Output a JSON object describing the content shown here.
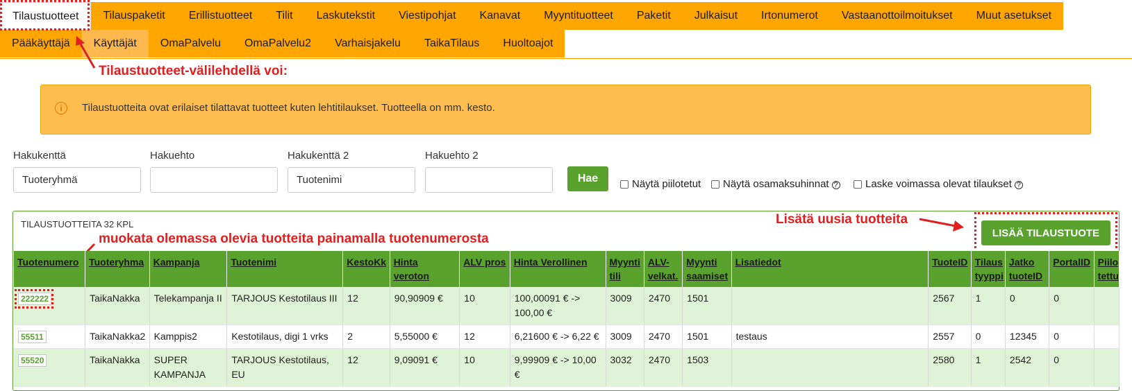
{
  "tabs_row1": [
    "Tilaustuotteet",
    "Tilauspaketit",
    "Erillistuotteet",
    "Tilit",
    "Laskutekstit",
    "Viestipohjat",
    "Kanavat",
    "Myyntituotteet",
    "Paketit",
    "Julkaisut",
    "Irtonumerot",
    "Vastaanottoilmoitukset",
    "Muut asetukset"
  ],
  "tabs_row2": [
    "Pääkäyttäjä",
    "Käyttäjät",
    "OmaPalvelu",
    "OmaPalvelu2",
    "Varhaisjakelu",
    "TaikaTilaus",
    "Huoltoajot"
  ],
  "annotations": {
    "tab_note": "Tilaustuotteet-välilehdellä voi:",
    "add_note": "Lisätä uusia tuotteita",
    "edit_note": "muokata olemassa olevia tuotteita painamalla tuotenumerosta"
  },
  "info": {
    "icon": "info-circle-icon",
    "text": "Tilaustuotteita ovat erilaiset tilattavat tuotteet kuten lehtitilaukset. Tuotteella on mm. kesto."
  },
  "search": {
    "label1": "Hakukenttä",
    "value1": "Tuoteryhmä",
    "label2": "Hakuehto",
    "value2": "",
    "label3": "Hakukenttä 2",
    "value3": "Tuotenimi",
    "label4": "Hakuehto 2",
    "value4": "",
    "button": "Hae",
    "check1": "Näytä piilotetut",
    "check2": "Näytä osamaksuhinnat",
    "check3": "Laske voimassa olevat tilaukset",
    "help": "?"
  },
  "list": {
    "title": "TILAUSTUOTTEITA 32 KPL",
    "add_button": "LISÄÄ TILAUSTUOTE",
    "headers": [
      "Tuotenumero",
      "Tuoteryhma",
      "Kampanja",
      "Tuotenimi",
      "KestoKk",
      "Hinta veroton",
      "ALV pros",
      "Hinta Verollinen",
      "Myynti tili",
      "ALV-velkat.",
      "Myynti saamiset",
      "Lisatiedot",
      "TuoteID",
      "Tilaus tyyppi",
      "Jatko tuoteID",
      "PortalID",
      "Piilo tettu"
    ],
    "rows": [
      [
        "222222",
        "TaikaNakka",
        "Telekampanja II",
        "TARJOUS Kestotilaus III",
        "12",
        "90,90909 €",
        "10",
        "100,00091 € -> 100,00 €",
        "3009",
        "2470",
        "1501",
        "",
        "2567",
        "1",
        "0",
        "0",
        ""
      ],
      [
        "55511",
        "TaikaNakka2",
        "Kamppis2",
        "Kestotilaus, digi 1 vrks",
        "2",
        "5,55000 €",
        "12",
        "6,21600 € -> 6,22 €",
        "3009",
        "2470",
        "1501",
        "testaus",
        "2557",
        "0",
        "12345",
        "0",
        ""
      ],
      [
        "55520",
        "TaikaNakka",
        "SUPER KAMPANJA",
        "TARJOUS Kestotilaus, EU",
        "12",
        "9,09091 €",
        "10",
        "9,99909 € -> 10,00 €",
        "3032",
        "2470",
        "1503",
        "",
        "2580",
        "1",
        "2542",
        "0",
        ""
      ]
    ]
  }
}
